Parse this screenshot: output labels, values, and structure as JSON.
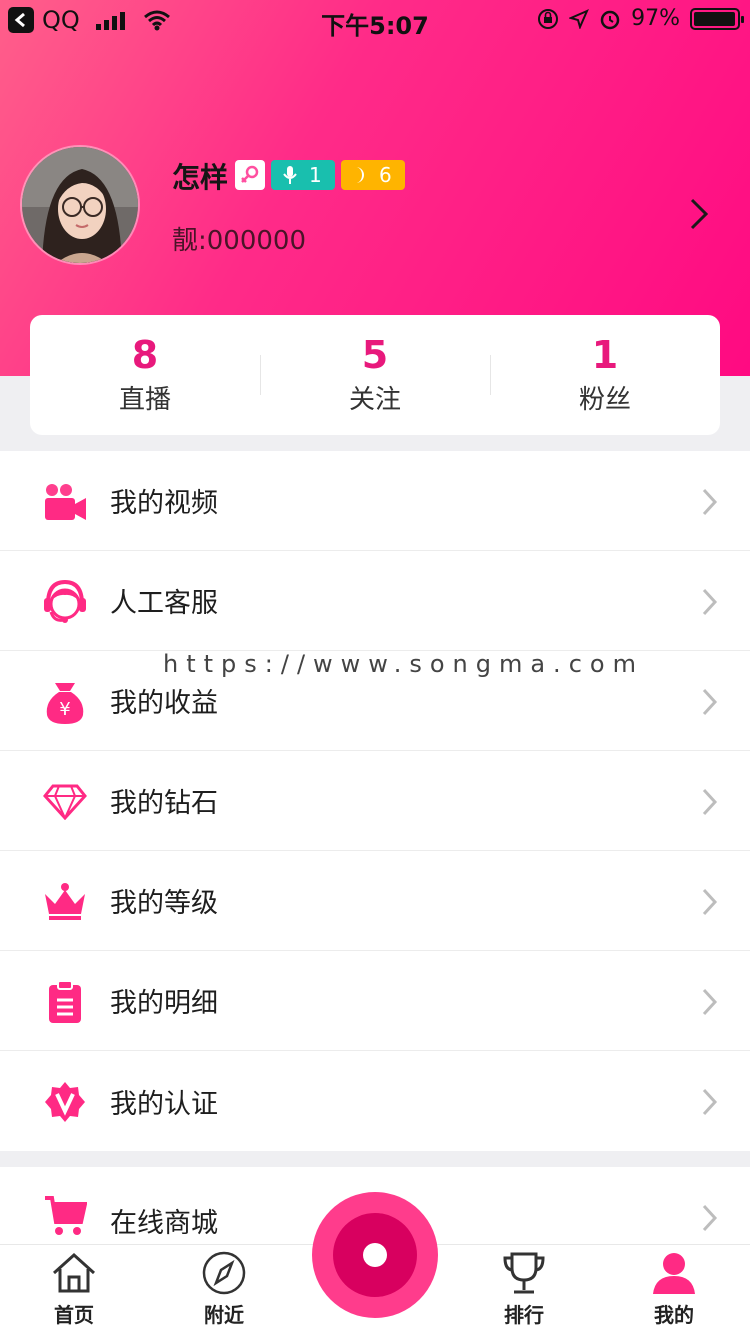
{
  "status_bar": {
    "carrier": "QQ",
    "time": "下午5:07",
    "battery": "97%",
    "battery_level": 0.97
  },
  "profile": {
    "name": "怎样",
    "badge_level_1": "1",
    "badge_level_2": "6",
    "user_id": "靓:000000"
  },
  "stats": [
    {
      "value": "8",
      "label": "直播"
    },
    {
      "value": "5",
      "label": "关注"
    },
    {
      "value": "1",
      "label": "粉丝"
    }
  ],
  "menu": [
    {
      "label": "我的视频",
      "icon": "video-camera-icon"
    },
    {
      "label": "人工客服",
      "icon": "customer-service-icon"
    },
    {
      "label": "我的收益",
      "icon": "money-bag-icon"
    },
    {
      "label": "我的钻石",
      "icon": "diamond-icon"
    },
    {
      "label": "我的等级",
      "icon": "crown-icon"
    },
    {
      "label": "我的明细",
      "icon": "clipboard-icon"
    },
    {
      "label": "我的认证",
      "icon": "verified-badge-icon"
    }
  ],
  "menu2": [
    {
      "label": "在线商城",
      "icon": "cart-icon"
    }
  ],
  "watermark": "https://www.songma.com",
  "tabbar": {
    "home": "首页",
    "nearby": "附近",
    "rank": "排行",
    "mine": "我的"
  },
  "colors": {
    "accent": "#e8197c",
    "header_start": "#ff5f8a",
    "header_end": "#ff0a82"
  }
}
